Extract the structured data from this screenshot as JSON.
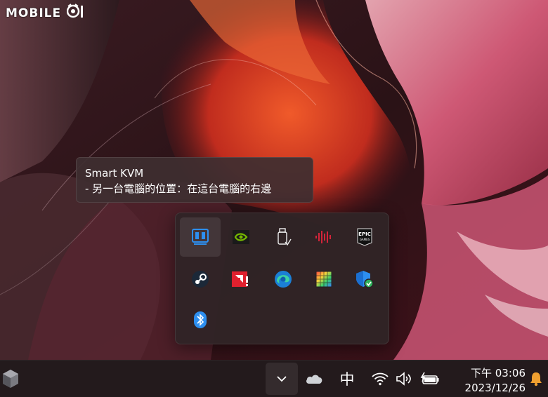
{
  "watermark": {
    "text": "MOBILE"
  },
  "tooltip": {
    "title": "Smart KVM",
    "subtitle": "- 另一台電腦的位置：在這台電腦的右邊"
  },
  "tray": {
    "icons": [
      {
        "name": "smart-kvm-icon",
        "active": true
      },
      {
        "name": "nvidia-icon"
      },
      {
        "name": "usb-drive-icon"
      },
      {
        "name": "audio-wave-icon"
      },
      {
        "name": "epic-games-icon",
        "label_line1": "EPIC",
        "label_line2": "GAMES"
      },
      {
        "name": "steam-icon"
      },
      {
        "name": "amd-icon"
      },
      {
        "name": "edge-icon"
      },
      {
        "name": "rgb-app-icon"
      },
      {
        "name": "windows-security-icon"
      },
      {
        "name": "bluetooth-icon"
      }
    ]
  },
  "taskbar": {
    "ime_label": "中",
    "time": "下午 03:06",
    "date": "2023/12/26"
  },
  "colors": {
    "accent_blue": "#2d8ff0",
    "nvidia_green": "#76b900",
    "amd_red": "#e0202e",
    "audio_red": "#d3243a",
    "security_green": "#2fb35b"
  }
}
